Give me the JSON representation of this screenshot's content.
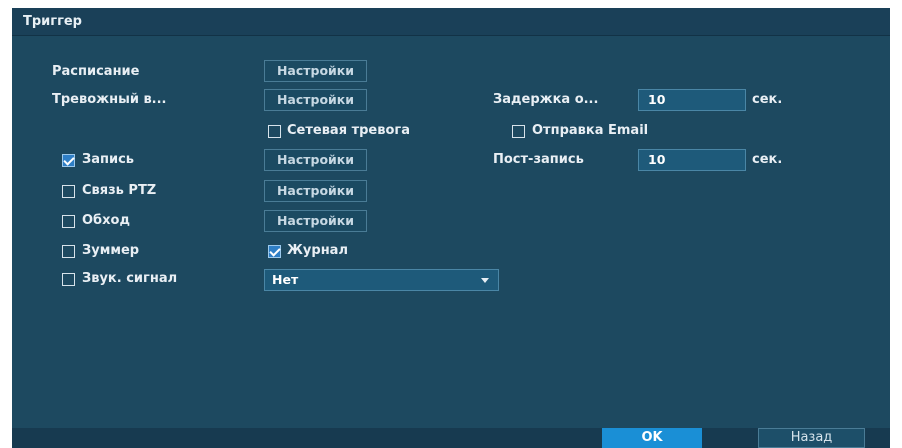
{
  "window": {
    "title": "Триггер"
  },
  "rows": {
    "schedule": {
      "label": "Расписание",
      "button": "Настройки"
    },
    "alarm_in": {
      "label": "Тревожный в...",
      "button": "Настройки",
      "delay_label": "Задержка о...",
      "delay_value": "10",
      "delay_unit": "сек."
    },
    "network_alarm": {
      "label": "Сетевая тревога",
      "checked": false
    },
    "send_email": {
      "label": "Отправка Email",
      "checked": false
    },
    "record": {
      "label": "Запись",
      "checked": true,
      "button": "Настройки",
      "post_label": "Пост-запись",
      "post_value": "10",
      "post_unit": "сек."
    },
    "ptz": {
      "label": "Связь PTZ",
      "checked": false,
      "button": "Настройки"
    },
    "tour": {
      "label": "Обход",
      "checked": false,
      "button": "Настройки"
    },
    "buzzer": {
      "label": "Зуммер",
      "checked": false
    },
    "log": {
      "label": "Журнал",
      "checked": true
    },
    "sound": {
      "label": "Звук. сигнал",
      "checked": false,
      "select_value": "Нет"
    }
  },
  "footer": {
    "ok_label": "OK",
    "back_label": "Назад"
  },
  "colors": {
    "background": "#1d4960",
    "accent": "#1a8fd6",
    "checkbox_checked": "#2f7fc6"
  }
}
